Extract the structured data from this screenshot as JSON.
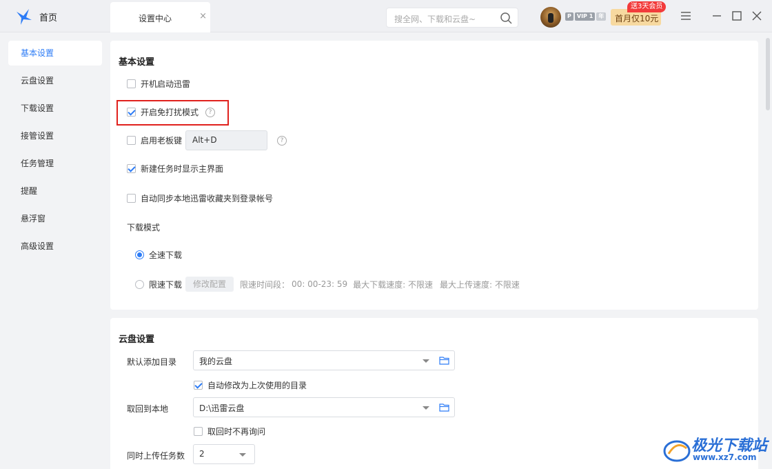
{
  "topbar": {
    "home_label": "首页",
    "tab_label": "设置中心",
    "tab_close": "×",
    "search_placeholder": "搜全网、下载和云盘~",
    "vip_badges": [
      "P",
      "VIP 1",
      "年"
    ],
    "promo_label": "首月仅10元",
    "promo_tag": "送3天会员"
  },
  "sidebar": {
    "items": [
      {
        "label": "基本设置",
        "active": true
      },
      {
        "label": "云盘设置"
      },
      {
        "label": "下载设置"
      },
      {
        "label": "接管设置"
      },
      {
        "label": "任务管理"
      },
      {
        "label": "提醒"
      },
      {
        "label": "悬浮窗"
      },
      {
        "label": "高级设置"
      }
    ]
  },
  "basic": {
    "title": "基本设置",
    "autostart": {
      "label": "开机启动迅雷",
      "checked": false
    },
    "dnd": {
      "label": "开启免打扰模式",
      "checked": true
    },
    "bosskey": {
      "label": "启用老板键",
      "checked": false,
      "value": "Alt+D"
    },
    "show_main": {
      "label": "新建任务时显示主界面",
      "checked": true
    },
    "sync_fav": {
      "label": "自动同步本地迅雷收藏夹到登录帐号",
      "checked": false
    },
    "download_mode": {
      "title": "下载模式",
      "full_speed": "全速下载",
      "limited": "限速下载",
      "modify_btn": "修改配置",
      "limit_period": "限速时间段：",
      "limit_time": "00: 00-23: 59",
      "max_download": "最大下载速度: 不限速",
      "max_upload": "最大上传速度: 不限速",
      "selected": "全速下载"
    }
  },
  "cloud": {
    "title": "云盘设置",
    "default_dir_label": "默认添加目录",
    "default_dir_value": "我的云盘",
    "auto_modify": {
      "label": "自动修改为上次使用的目录",
      "checked": true
    },
    "retrieve_label": "取回到本地",
    "retrieve_value": "D:\\迅雷云盘",
    "no_ask": {
      "label": "取回时不再询问",
      "checked": false
    },
    "upload_count_label": "同时上传任务数",
    "upload_count_value": "2"
  },
  "watermark": {
    "text": "极光下载站",
    "url": "www.xz7.com"
  },
  "colors": {
    "accent": "#2d7cf6",
    "highlight": "#e0201c",
    "promo": "#f7d9a0"
  }
}
